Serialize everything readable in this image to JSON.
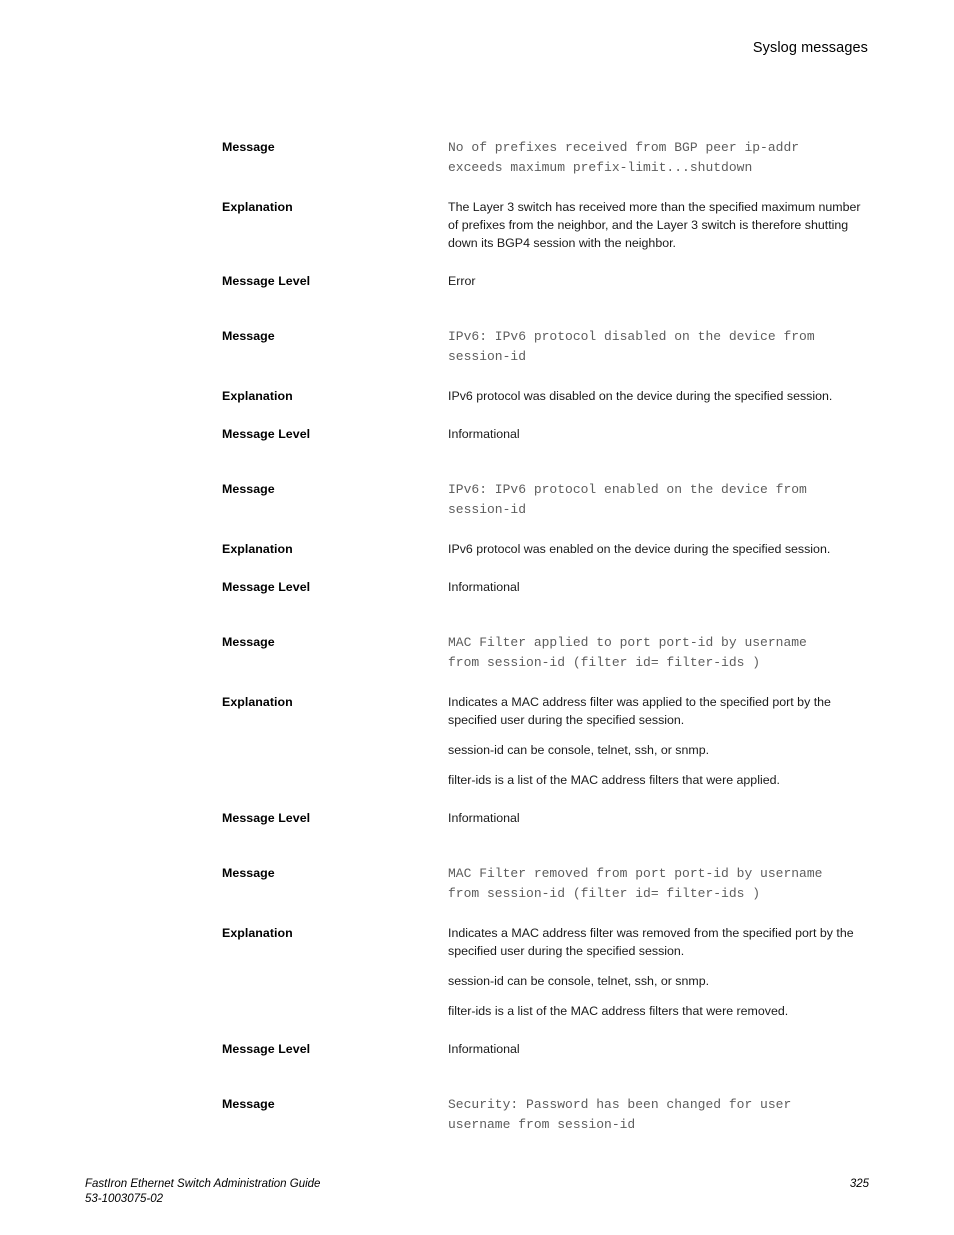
{
  "header": {
    "title": "Syslog messages"
  },
  "labels": {
    "message": "Message",
    "explanation": "Explanation",
    "message_level": "Message Level"
  },
  "blocks": [
    {
      "message": "No of prefixes received from BGP peer ip-addr\nexceeds maximum prefix-limit...shutdown",
      "explanation_paragraphs": [
        "The Layer 3 switch has received more than the specified maximum number of prefixes from the neighbor, and the Layer 3 switch is therefore shutting down its BGP4 session with the neighbor."
      ],
      "message_level": "Error"
    },
    {
      "message": "IPv6: IPv6 protocol disabled on the device from\nsession-id",
      "explanation_paragraphs": [
        "IPv6 protocol was disabled on the device during the specified session."
      ],
      "message_level": "Informational"
    },
    {
      "message": "IPv6: IPv6 protocol enabled on the device from\nsession-id",
      "explanation_paragraphs": [
        "IPv6 protocol was enabled on the device during the specified session."
      ],
      "message_level": "Informational"
    },
    {
      "message": "MAC Filter applied to port port-id by username\nfrom session-id (filter id= filter-ids )",
      "explanation_paragraphs": [
        "Indicates a MAC address filter was applied to the specified port by the specified user during the specified session.",
        "session-id can be console, telnet, ssh, or snmp.",
        "filter-ids is a list of the MAC address filters that were applied."
      ],
      "message_level": "Informational"
    },
    {
      "message": "MAC Filter removed from port port-id by username\nfrom session-id (filter id= filter-ids )",
      "explanation_paragraphs": [
        "Indicates a MAC address filter was removed from the specified port by the specified user during the specified session.",
        "session-id can be console, telnet, ssh, or snmp.",
        "filter-ids is a list of the MAC address filters that were removed."
      ],
      "message_level": "Informational"
    },
    {
      "message": "Security: Password has been changed for user\nusername from session-id",
      "explanation_paragraphs": [],
      "message_level": null
    }
  ],
  "footer": {
    "guide_title": "FastIron Ethernet Switch Administration Guide",
    "document_number": "53-1003075-02",
    "page_number": "325"
  }
}
